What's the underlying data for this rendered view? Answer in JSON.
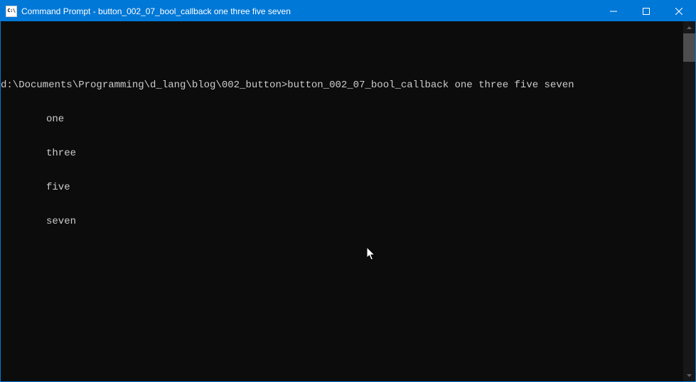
{
  "window": {
    "title": "Command Prompt - button_002_07_bool_callback  one three five seven",
    "icon_label": "C:\\"
  },
  "console": {
    "prompt_path": "d:\\Documents\\Programming\\d_lang\\blog\\002_button>",
    "command": "button_002_07_bool_callback one three five seven",
    "output_lines": [
      "one",
      "three",
      "five",
      "seven"
    ]
  },
  "colors": {
    "titlebar": "#0078d7",
    "console_bg": "#0c0c0c",
    "console_fg": "#cccccc"
  }
}
